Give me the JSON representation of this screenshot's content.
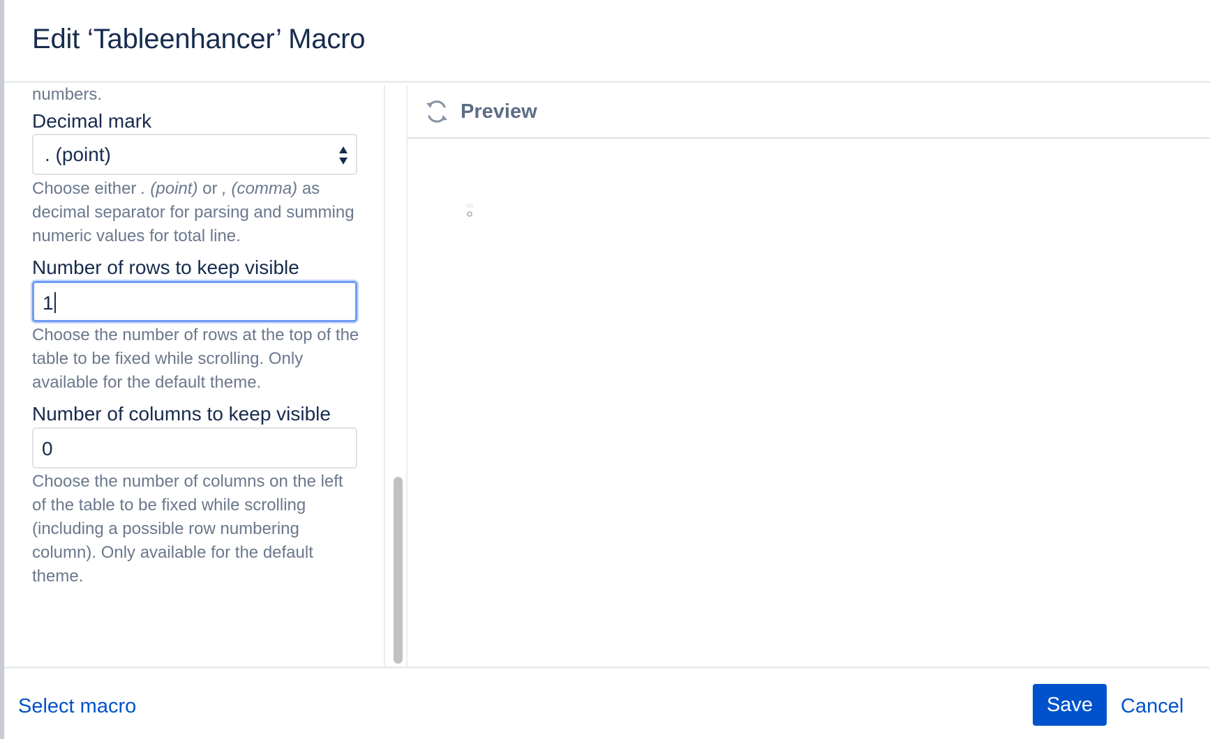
{
  "dialog": {
    "title": "Edit ‘Tableenhancer’ Macro"
  },
  "settings": {
    "previous_help_tail": "numbers.",
    "decimal_mark": {
      "label": "Decimal mark",
      "selected": ". (point)",
      "help_prefix": "Choose either ",
      "help_point": ". (point)",
      "help_or": " or ",
      "help_comma": ", (comma)",
      "help_suffix": " as decimal separator for parsing and summing numeric values for total line."
    },
    "rows_visible": {
      "label": "Number of rows to keep visible",
      "value": "1",
      "help": "Choose the number of rows at the top of the table to be fixed while scrolling. Only available for the default theme."
    },
    "columns_visible": {
      "label": "Number of columns to keep visible",
      "value": "0",
      "help": "Choose the number of columns on the left of the table to be fixed while scrolling (including a possible row numbering column). Only available for the default theme."
    }
  },
  "preview": {
    "title": "Preview",
    "refresh_icon": "refresh-icon",
    "loading_icon": "loading-spinner-icon"
  },
  "footer": {
    "select_macro": "Select macro",
    "save": "Save",
    "cancel": "Cancel"
  },
  "colors": {
    "primary": "#0052cc",
    "title_text": "#172b4d",
    "help_text": "#6b778c",
    "focus_ring": "#6f9bf5"
  }
}
